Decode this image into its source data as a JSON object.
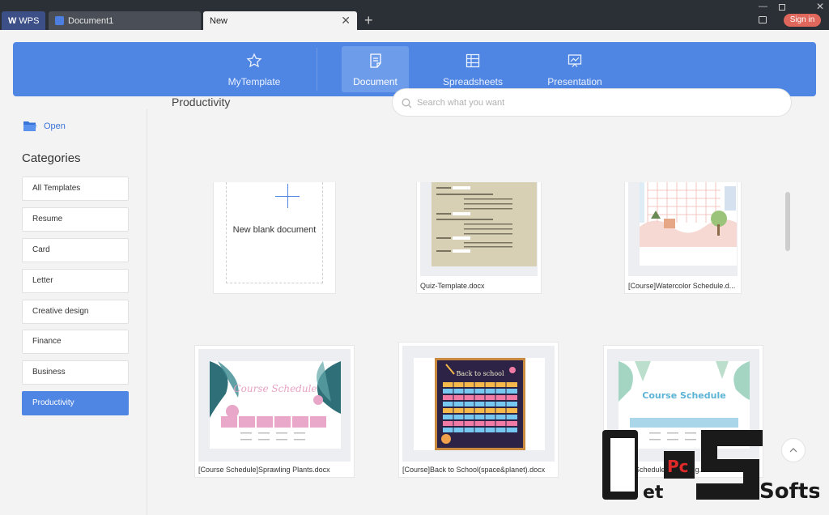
{
  "titlebar": {
    "tabs": [
      {
        "label": "WPS"
      },
      {
        "label": "Document1"
      },
      {
        "label": "New"
      }
    ],
    "add_tab": "+",
    "close_tab": "✕",
    "sign_in": "Sign in"
  },
  "topnav": {
    "items": [
      {
        "label": "MyTemplate",
        "icon": "star-template-icon"
      },
      {
        "label": "Document",
        "icon": "document-icon",
        "active": true
      },
      {
        "label": "Spreadsheets",
        "icon": "spreadsheet-icon"
      },
      {
        "label": "Presentation",
        "icon": "presentation-icon"
      }
    ]
  },
  "sidebar": {
    "open_label": "Open",
    "categories_title": "Categories",
    "categories": [
      {
        "label": "All Templates"
      },
      {
        "label": "Resume"
      },
      {
        "label": "Card"
      },
      {
        "label": "Letter"
      },
      {
        "label": "Creative design"
      },
      {
        "label": "Finance"
      },
      {
        "label": "Business"
      },
      {
        "label": "Productivity",
        "active": true
      }
    ]
  },
  "content": {
    "title": "Productivity",
    "search_placeholder": "Search what you want",
    "blank_label": "New blank document",
    "cards": [
      {
        "label": "Quiz-Template.docx"
      },
      {
        "label": "[Course]Watercolor Schedule.d..."
      },
      {
        "label": "[Course Schedule]Sprawling Plants.docx"
      },
      {
        "label": "[Course]Back to School(space&planet).docx"
      },
      {
        "label": "[Course Schedule]Sprawling..."
      }
    ],
    "thumb_titles": {
      "sprawling": "Course Schedule",
      "school": "Back to school",
      "watercolor2": "Course Schedule"
    }
  },
  "colors": {
    "accent": "#4f86e3",
    "titlebar": "#2b2f36",
    "signin": "#e0675b"
  },
  "watermark": {
    "letters_a": "G",
    "letters_b": "et",
    "letters_c": "Pc",
    "letters_d": "Softs"
  }
}
